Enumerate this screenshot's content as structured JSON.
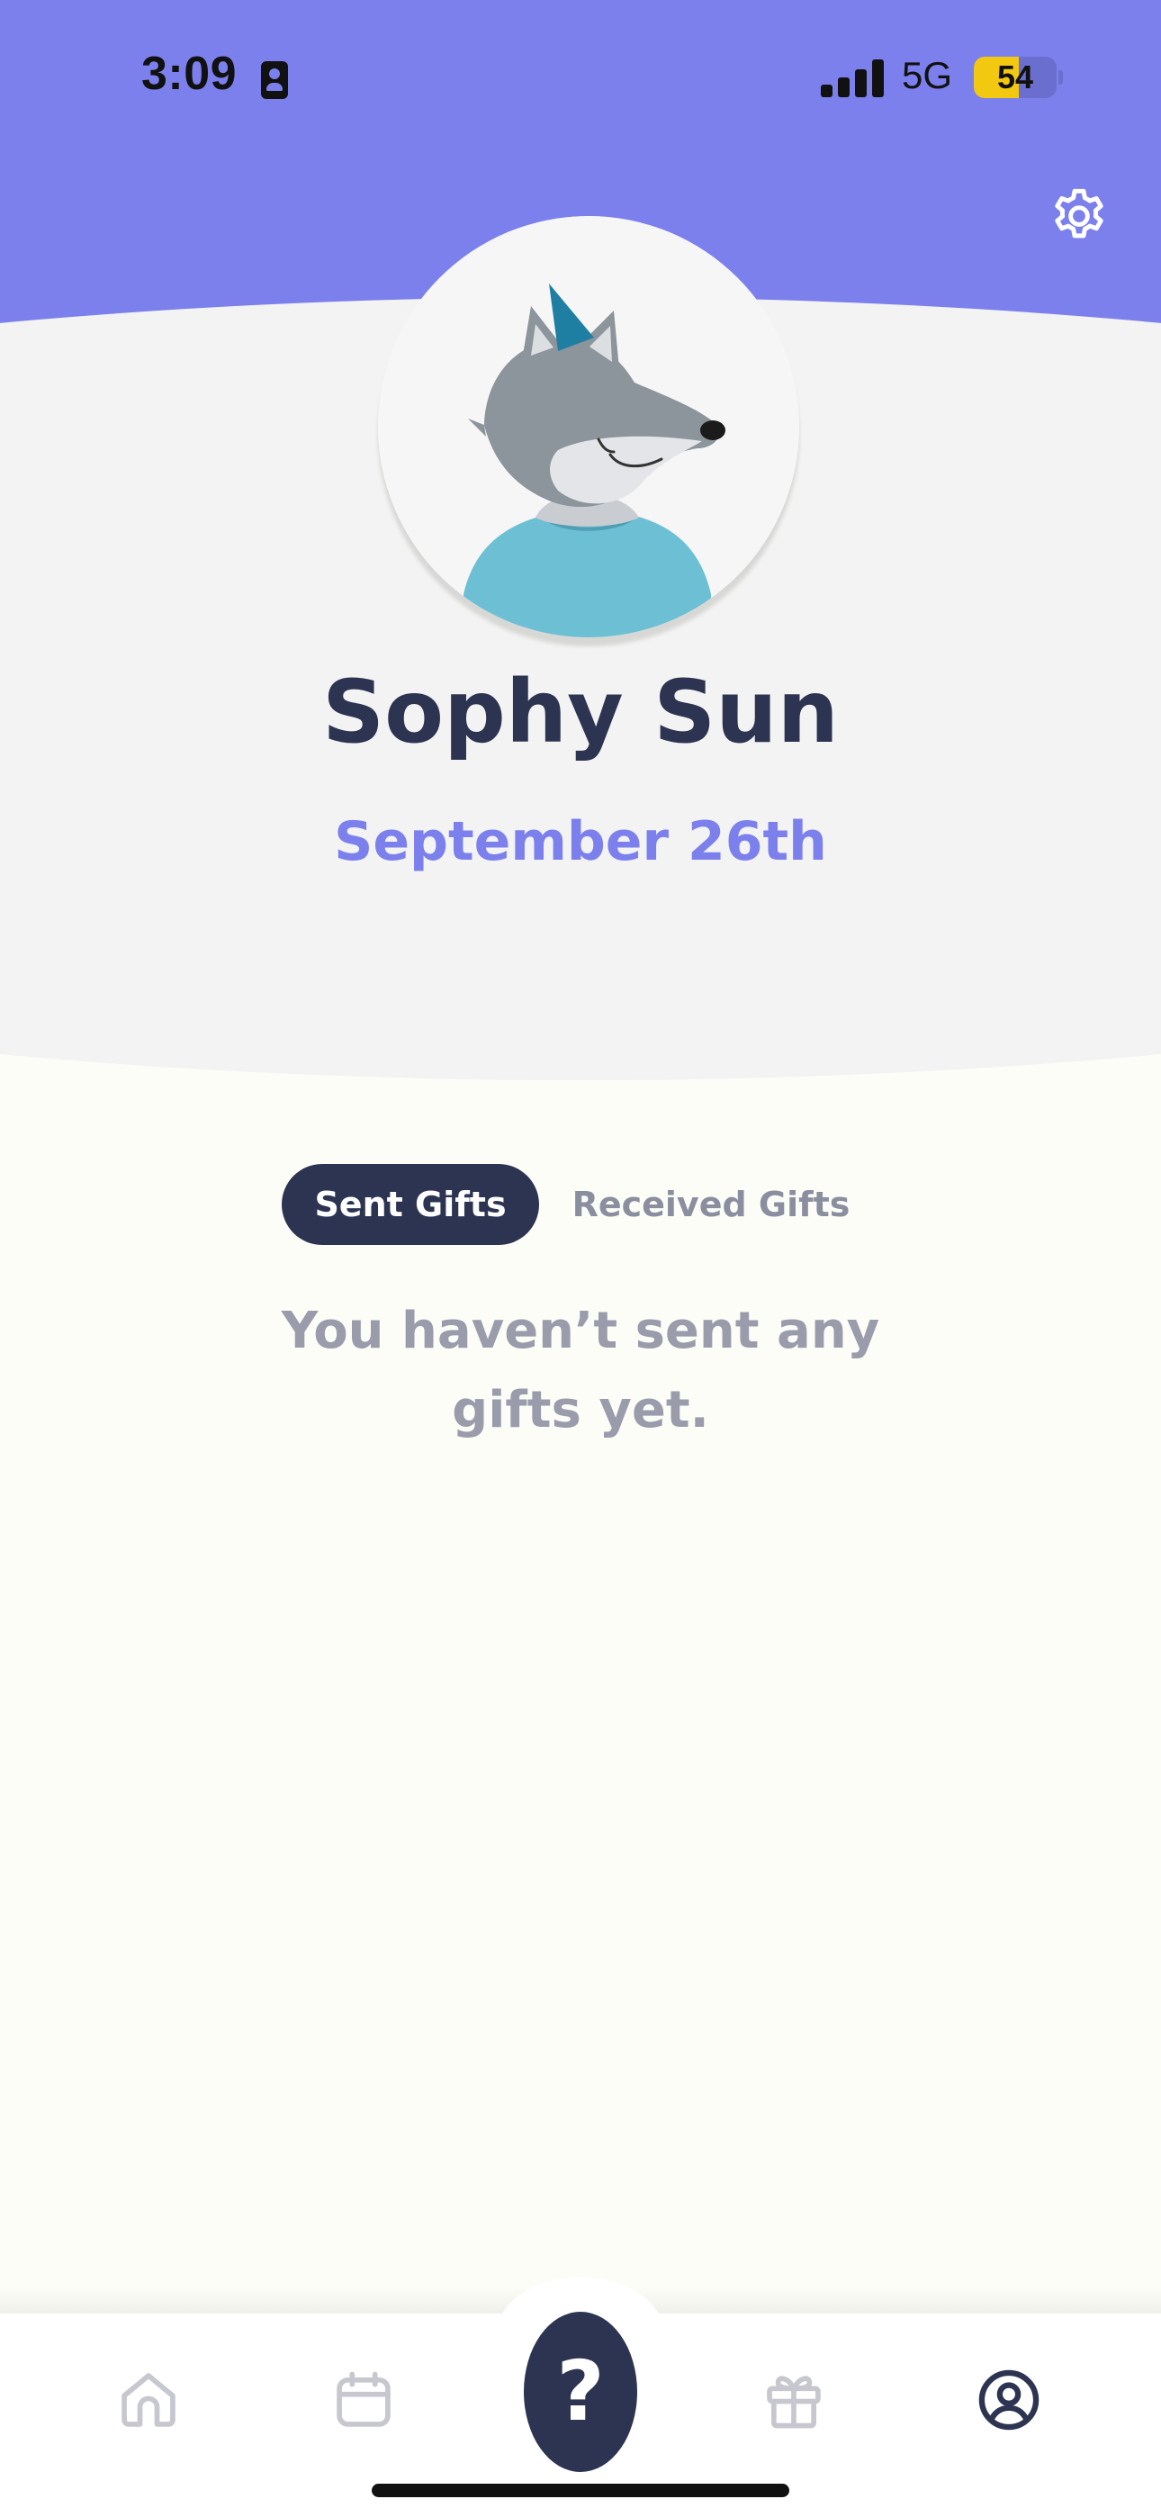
{
  "status_bar": {
    "time": "3:09",
    "network": "5G",
    "battery": "54",
    "battery_level": 0.54
  },
  "profile": {
    "name": "Sophy Sun",
    "birthday": "September 26th",
    "avatar": "wolf-party-hat-avatar"
  },
  "tabs": [
    {
      "label": "Sent Gifts",
      "active": true
    },
    {
      "label": "Received Gifts",
      "active": false
    }
  ],
  "empty_state": "You haven’t sent any gifts yet.",
  "bottom_nav": {
    "items": [
      {
        "icon": "home-icon",
        "active": false
      },
      {
        "icon": "calendar-icon",
        "active": false
      },
      {
        "icon": "question-icon",
        "label": "?",
        "active": false
      },
      {
        "icon": "gift-icon",
        "active": false
      },
      {
        "icon": "profile-icon",
        "active": true
      }
    ]
  },
  "colors": {
    "header_purple": "#7c80ec",
    "navy": "#2d3452",
    "muted_gray": "#9a9cab",
    "background": "#fdfdf8"
  }
}
